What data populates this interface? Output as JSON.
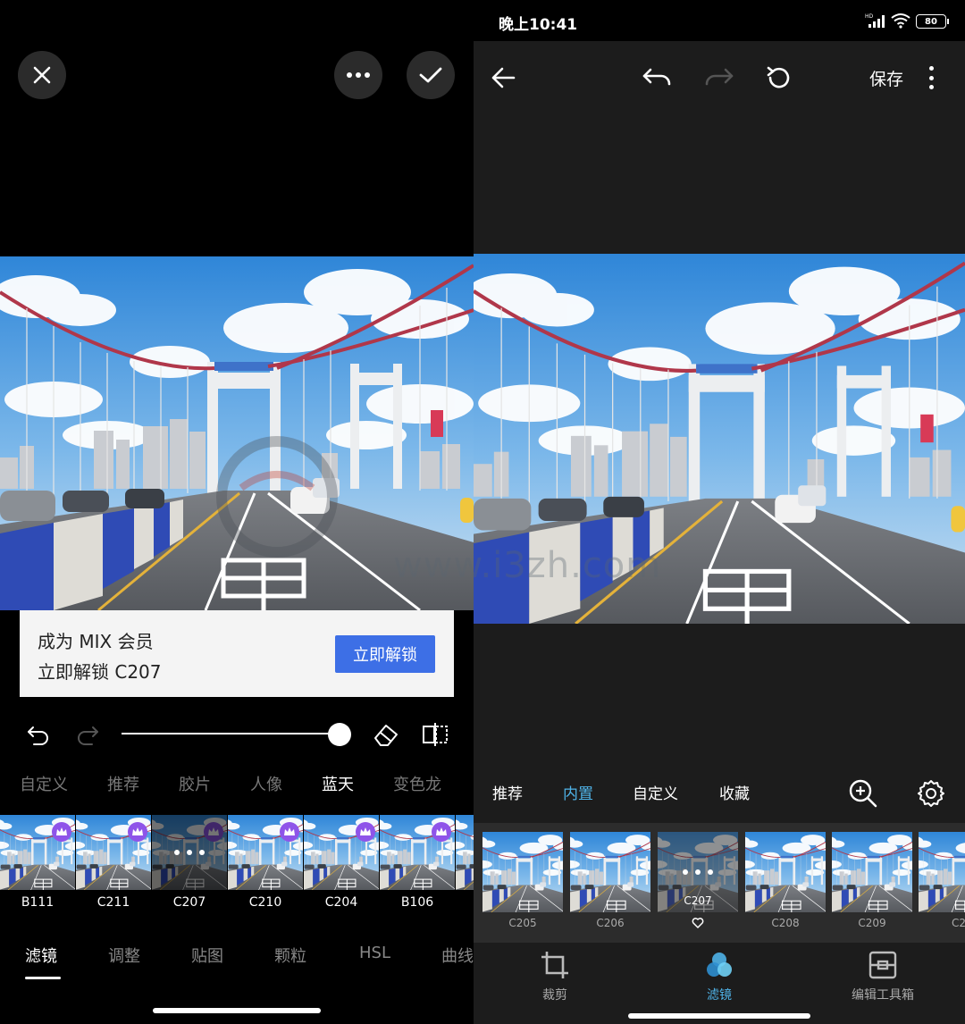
{
  "left": {
    "promo": {
      "line1": "成为 MIX 会员",
      "line2": "立即解锁 C207",
      "button": "立即解锁"
    },
    "slider": {
      "value": 1.0
    },
    "categories": [
      {
        "label": "自定义",
        "active": false
      },
      {
        "label": "推荐",
        "active": false
      },
      {
        "label": "胶片",
        "active": false
      },
      {
        "label": "人像",
        "active": false
      },
      {
        "label": "蓝天",
        "active": true
      },
      {
        "label": "变色龙",
        "active": false
      }
    ],
    "filters": [
      {
        "label": "B111",
        "premium": true,
        "selected": false
      },
      {
        "label": "C211",
        "premium": true,
        "selected": false
      },
      {
        "label": "C207",
        "premium": true,
        "selected": true
      },
      {
        "label": "C210",
        "premium": true,
        "selected": false
      },
      {
        "label": "C204",
        "premium": true,
        "selected": false
      },
      {
        "label": "B106",
        "premium": true,
        "selected": false
      },
      {
        "label": "",
        "premium": false,
        "selected": false
      }
    ],
    "tabs": [
      {
        "label": "滤镜",
        "active": true
      },
      {
        "label": "调整",
        "active": false
      },
      {
        "label": "贴图",
        "active": false
      },
      {
        "label": "颗粒",
        "active": false
      },
      {
        "label": "HSL",
        "active": false
      },
      {
        "label": "曲线",
        "active": false
      }
    ],
    "icons": {
      "close": "close-icon",
      "more": "more-icon",
      "confirm": "check-icon",
      "undo": "undo-icon",
      "redo": "redo-icon",
      "eraser": "eraser-icon",
      "compare": "compare-icon",
      "crown": "crown-icon"
    }
  },
  "right": {
    "status": {
      "time": "晚上10:41",
      "battery": "80",
      "network": "HD"
    },
    "toolbar": {
      "save": "保存"
    },
    "categories": [
      {
        "label": "推荐",
        "active": false
      },
      {
        "label": "内置",
        "active": true
      },
      {
        "label": "自定义",
        "active": false
      },
      {
        "label": "收藏",
        "active": false
      }
    ],
    "filters": [
      {
        "label": "C205",
        "selected": false
      },
      {
        "label": "C206",
        "selected": false
      },
      {
        "label": "C207",
        "selected": true
      },
      {
        "label": "C208",
        "selected": false
      },
      {
        "label": "C209",
        "selected": false
      },
      {
        "label": "C2",
        "selected": false
      }
    ],
    "tools": [
      {
        "label": "裁剪",
        "icon": "crop-icon",
        "active": false
      },
      {
        "label": "滤镜",
        "icon": "filter-icon",
        "active": true
      },
      {
        "label": "编辑工具箱",
        "icon": "toolbox-icon",
        "active": false
      }
    ]
  },
  "watermark": {
    "text": "www.i3zh.com"
  },
  "colors": {
    "accent_blue": "#4fb3e8",
    "unlock_button": "#3d6fe6",
    "crown_badge": "#8e54e9",
    "panel_bg_right": "#1c1c1c"
  }
}
